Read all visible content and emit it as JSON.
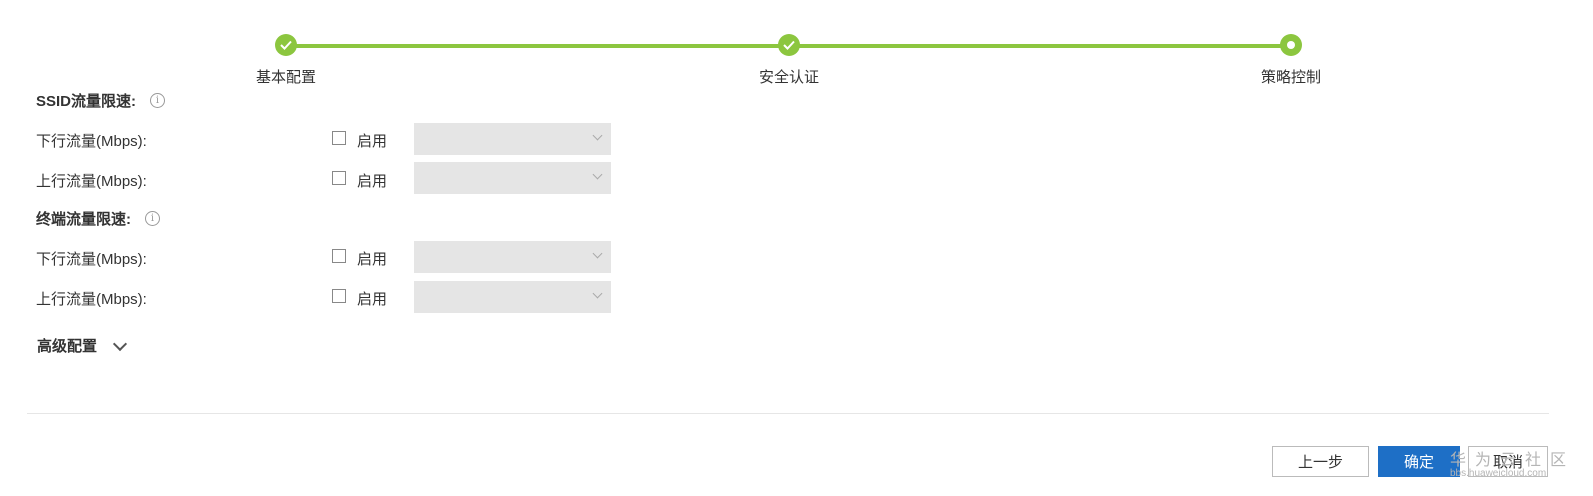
{
  "stepper": {
    "steps": [
      {
        "label": "基本配置",
        "state": "done"
      },
      {
        "label": "安全认证",
        "state": "done"
      },
      {
        "label": "策略控制",
        "state": "current"
      }
    ],
    "color": "#8cc63f"
  },
  "ssid_section": {
    "title": "SSID流量限速:",
    "downlink": {
      "label": "下行流量(Mbps):",
      "enable_label": "启用",
      "checked": false,
      "value": ""
    },
    "uplink": {
      "label": "上行流量(Mbps):",
      "enable_label": "启用",
      "checked": false,
      "value": ""
    }
  },
  "terminal_section": {
    "title": "终端流量限速:",
    "downlink": {
      "label": "下行流量(Mbps):",
      "enable_label": "启用",
      "checked": false,
      "value": ""
    },
    "uplink": {
      "label": "上行流量(Mbps):",
      "enable_label": "启用",
      "checked": false,
      "value": ""
    }
  },
  "advanced": {
    "label": "高级配置"
  },
  "footer": {
    "prev_label": "上一步",
    "ok_label": "确定",
    "cancel_label": "取消",
    "ok_color": "#1e6fc6"
  },
  "watermark": {
    "main": "华为云社区",
    "sub": "bbs.huaweicloud.com"
  }
}
